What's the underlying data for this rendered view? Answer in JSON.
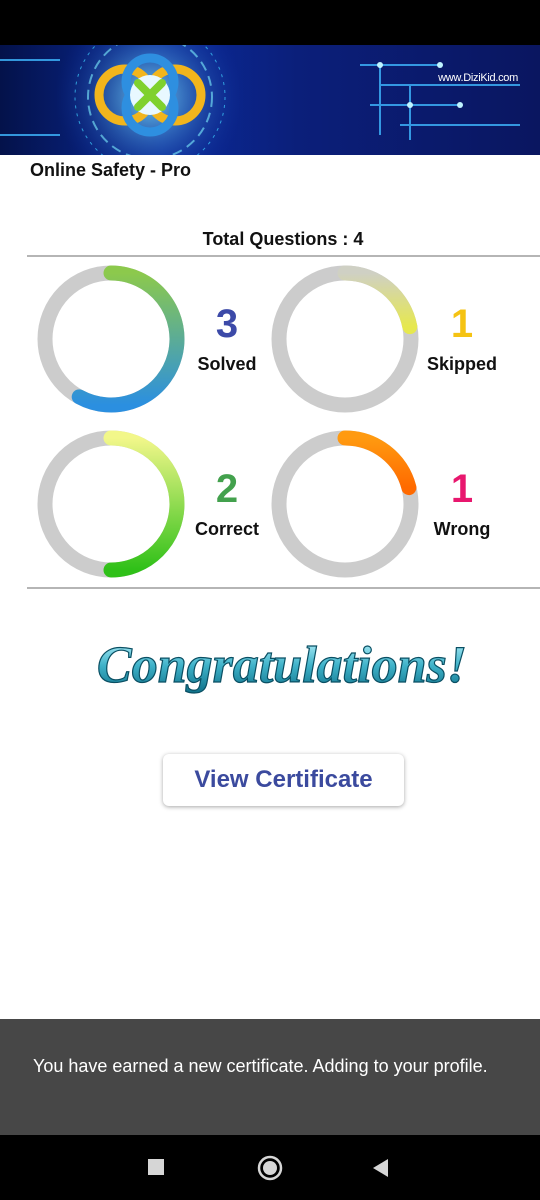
{
  "banner": {
    "url_text": "www.DiziKid.com"
  },
  "app_title": "Online Safety - Pro",
  "total_questions_label": "Total Questions : 4",
  "stats": [
    {
      "label": "Solved",
      "value": "3",
      "color": "#3c4aa8",
      "fraction": 0.58,
      "gradient": [
        "#2b8fe0",
        "#8cc94c"
      ]
    },
    {
      "label": "Skipped",
      "value": "1",
      "color": "#f5c313",
      "fraction": 0.22,
      "gradient": [
        "#e6e84f",
        "#cfd0c4"
      ]
    },
    {
      "label": "Correct",
      "value": "2",
      "color": "#43a14d",
      "fraction": 0.5,
      "gradient": [
        "#2fc018",
        "#f2f78a"
      ]
    },
    {
      "label": "Wrong",
      "value": "1",
      "color": "#e8176e",
      "fraction": 0.21,
      "gradient": [
        "#ff6a00",
        "#ff9a10"
      ]
    }
  ],
  "congrats_text": "Congratulations!",
  "view_certificate_label": "View Certificate",
  "snackbar_text": "You have earned a new certificate. Adding to your profile.",
  "icons": {
    "logo": "dizikid-logo-icon",
    "recents": "square-icon",
    "home": "circle-icon",
    "back": "triangle-back-icon"
  }
}
